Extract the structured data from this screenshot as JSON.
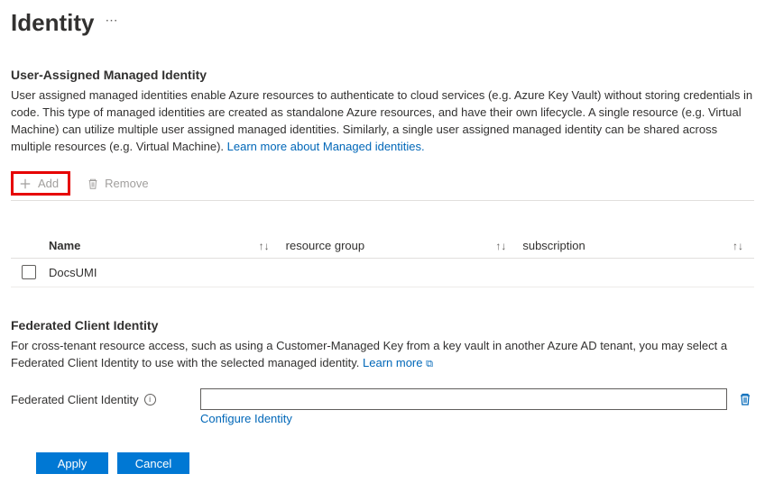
{
  "page": {
    "title": "Identity"
  },
  "uami": {
    "section_title": "User-Assigned Managed Identity",
    "description": "User assigned managed identities enable Azure resources to authenticate to cloud services (e.g. Azure Key Vault) without storing credentials in code. This type of managed identities are created as standalone Azure resources, and have their own lifecycle. A single resource (e.g. Virtual Machine) can utilize multiple user assigned managed identities. Similarly, a single user assigned managed identity can be shared across multiple resources (e.g. Virtual Machine). ",
    "learn_more": "Learn more about Managed identities.",
    "add": "Add",
    "remove": "Remove",
    "columns": {
      "name": "Name",
      "rg": "resource group",
      "sub": "subscription"
    },
    "rows": [
      {
        "name": "DocsUMI",
        "rg": "",
        "sub": ""
      }
    ]
  },
  "federated": {
    "section_title": "Federated Client Identity",
    "description": "For cross-tenant resource access, such as using a Customer-Managed Key from a key vault in another Azure AD tenant, you may select a Federated Client Identity to use with the selected managed identity. ",
    "learn_more": "Learn more",
    "label": "Federated Client Identity",
    "value": "",
    "configure": "Configure Identity"
  },
  "footer": {
    "apply": "Apply",
    "cancel": "Cancel"
  }
}
